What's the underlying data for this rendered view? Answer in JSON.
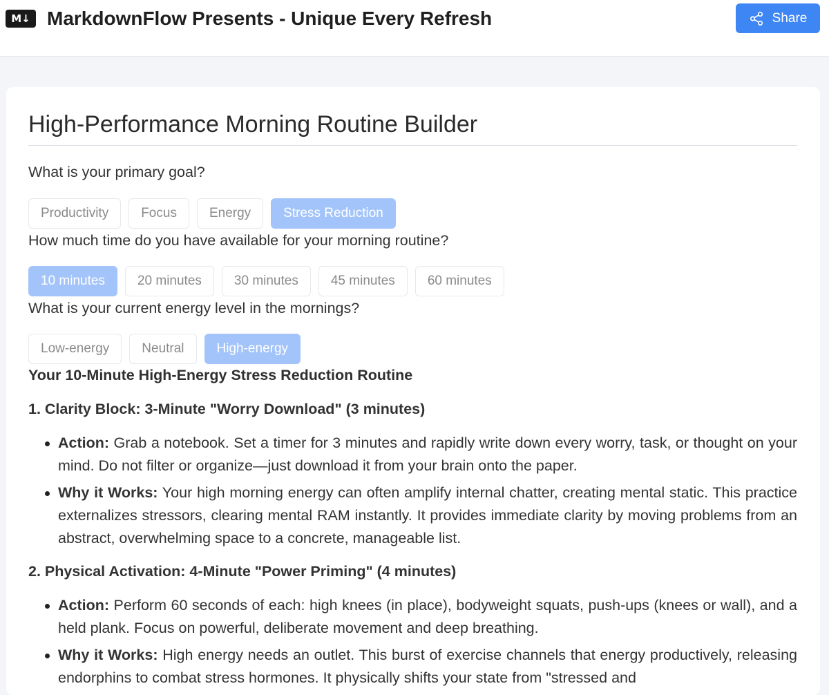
{
  "header": {
    "logo_text": "M↓",
    "title": "MarkdownFlow Presents - Unique Every Refresh",
    "share_label": "Share",
    "share_icon": "share-icon"
  },
  "main": {
    "title": "High-Performance Morning Routine Builder",
    "questions": [
      {
        "label": "What is your primary goal?",
        "options": [
          "Productivity",
          "Focus",
          "Energy",
          "Stress Reduction"
        ],
        "selected": "Stress Reduction"
      },
      {
        "label": "How much time do you have available for your morning routine?",
        "options": [
          "10 minutes",
          "20 minutes",
          "30 minutes",
          "45 minutes",
          "60 minutes"
        ],
        "selected": "10 minutes"
      },
      {
        "label": "What is your current energy level in the mornings?",
        "options": [
          "Low-energy",
          "Neutral",
          "High-energy"
        ],
        "selected": "High-energy"
      }
    ],
    "result_title": "Your 10-Minute High-Energy Stress Reduction Routine",
    "sections": [
      {
        "heading": "1. Clarity Block: 3-Minute \"Worry Download\" (3 minutes)",
        "items": [
          {
            "label": "Action:",
            "text": " Grab a notebook. Set a timer for 3 minutes and rapidly write down every worry, task, or thought on your mind. Do not filter or organize—just download it from your brain onto the paper."
          },
          {
            "label": "Why it Works:",
            "text": " Your high morning energy can often amplify internal chatter, creating mental static. This practice externalizes stressors, clearing mental RAM instantly. It provides immediate clarity by moving problems from an abstract, overwhelming space to a concrete, manageable list."
          }
        ]
      },
      {
        "heading": "2. Physical Activation: 4-Minute \"Power Priming\" (4 minutes)",
        "items": [
          {
            "label": "Action:",
            "text": " Perform 60 seconds of each: high knees (in place), bodyweight squats, push-ups (knees or wall), and a held plank. Focus on powerful, deliberate movement and deep breathing."
          },
          {
            "label": "Why it Works:",
            "text": " High energy needs an outlet. This burst of exercise channels that energy productively, releasing endorphins to combat stress hormones. It physically shifts your state from \"stressed and"
          }
        ]
      }
    ]
  }
}
